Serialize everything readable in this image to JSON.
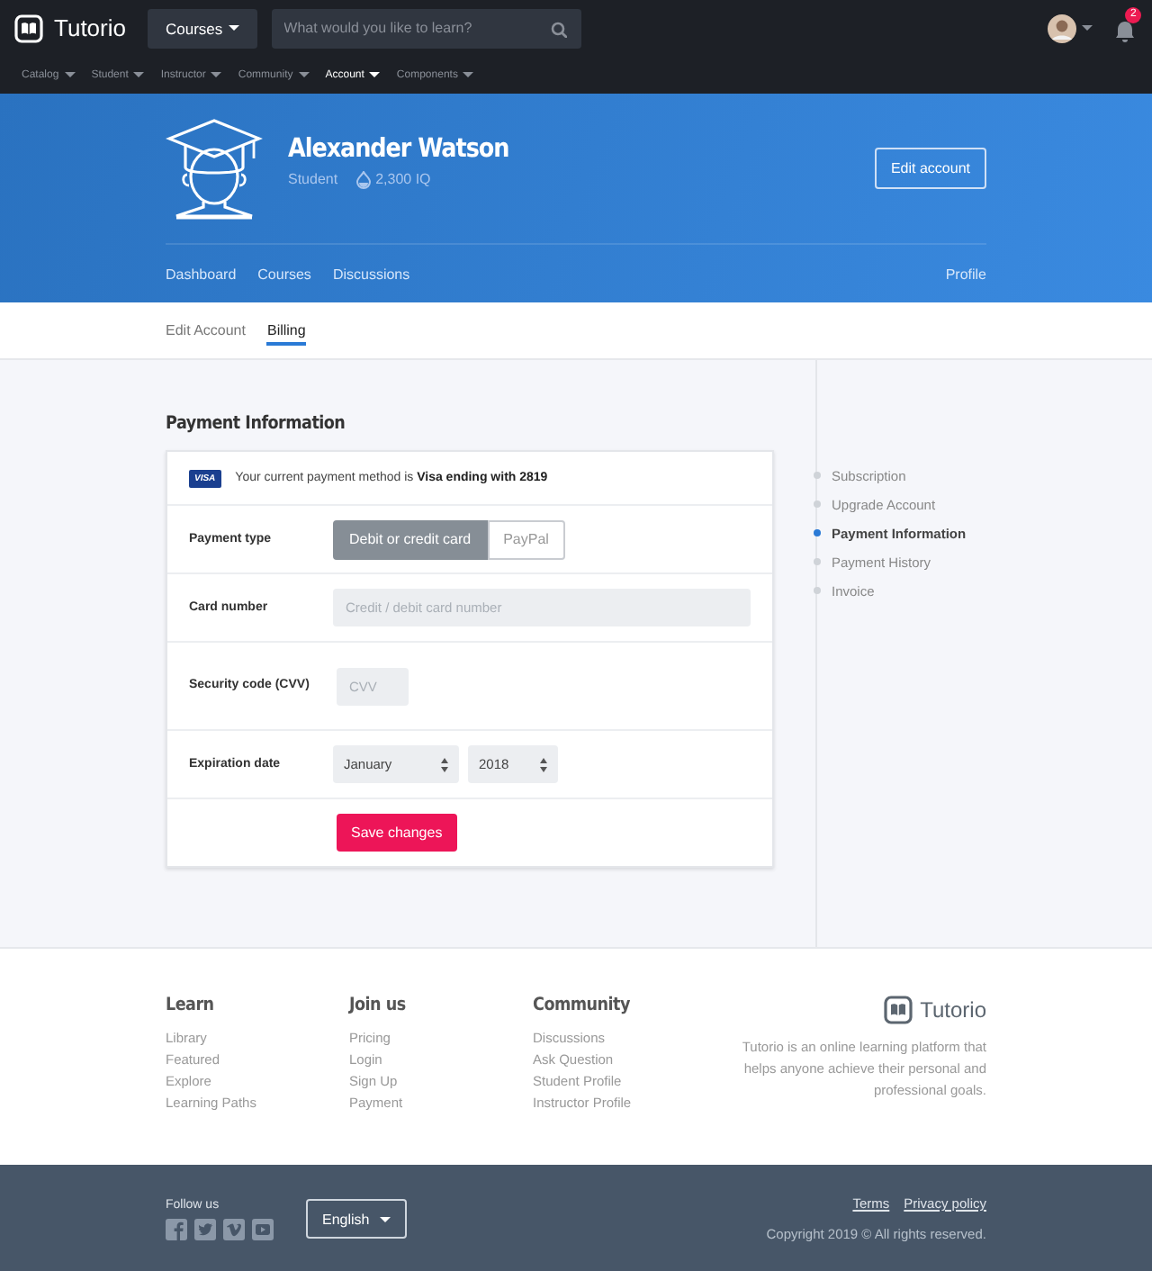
{
  "brand": {
    "name": "Tutorio"
  },
  "topbar": {
    "courses_button": "Courses",
    "search": {
      "placeholder": "What would you like to learn?"
    },
    "notification_count": "2"
  },
  "menu": [
    {
      "label": "Catalog",
      "selected": false
    },
    {
      "label": "Student",
      "selected": false
    },
    {
      "label": "Instructor",
      "selected": false
    },
    {
      "label": "Community",
      "selected": false
    },
    {
      "label": "Account",
      "selected": true
    },
    {
      "label": "Components",
      "selected": false
    }
  ],
  "profile": {
    "name": "Alexander Watson",
    "role": "Student",
    "points": "2,300 IQ",
    "edit_button": "Edit account"
  },
  "profile_nav": [
    {
      "label": "Dashboard"
    },
    {
      "label": "Courses"
    },
    {
      "label": "Discussions"
    }
  ],
  "profile_link": "Profile",
  "tabs": [
    {
      "label": "Edit Account",
      "selected": false
    },
    {
      "label": "Billing",
      "selected": true
    }
  ],
  "payment": {
    "title": "Payment Information",
    "card_badge": "VISA",
    "current_method": "Your current payment method is **Visa ending with 2819**",
    "payment_type_label": "Payment type",
    "payment_types": [
      {
        "label": "Debit or credit card",
        "selected": true
      },
      {
        "label": "PayPal",
        "selected": false
      }
    ],
    "card_number": {
      "label": "Card number",
      "placeholder": "Credit / debit card number"
    },
    "security_code": {
      "label": "Security code (CVV)",
      "placeholder": "CVV"
    },
    "expiration": {
      "label": "Expiration date",
      "month": "January",
      "year": "2018"
    },
    "save_button": "Save changes"
  },
  "side_nav": [
    {
      "label": "Subscription",
      "selected": false
    },
    {
      "label": "Upgrade Account",
      "selected": false
    },
    {
      "label": "Payment Information",
      "selected": true
    },
    {
      "label": "Payment History",
      "selected": false
    },
    {
      "label": "Invoice",
      "selected": false
    }
  ],
  "footer": {
    "columns": [
      {
        "title": "Learn",
        "links": [
          "Library",
          "Featured",
          "Explore",
          "Learning Paths"
        ]
      },
      {
        "title": "Join us",
        "links": [
          "Pricing",
          "Login",
          "Sign Up",
          "Payment"
        ]
      },
      {
        "title": "Community",
        "links": [
          "Discussions",
          "Ask Question",
          "Student Profile",
          "Instructor Profile"
        ]
      }
    ],
    "brand": "Tutorio",
    "about": "Tutorio is an online learning platform that helps anyone achieve their personal and professional goals.",
    "follow_label": "Follow us",
    "social": [
      {
        "kind": "facebook"
      },
      {
        "kind": "twitter"
      },
      {
        "kind": "vimeo"
      },
      {
        "kind": "youtube"
      }
    ],
    "language": "English",
    "links": [
      "Terms",
      "Privacy policy"
    ],
    "copyright": "Copyright 2019 © All rights reserved."
  }
}
